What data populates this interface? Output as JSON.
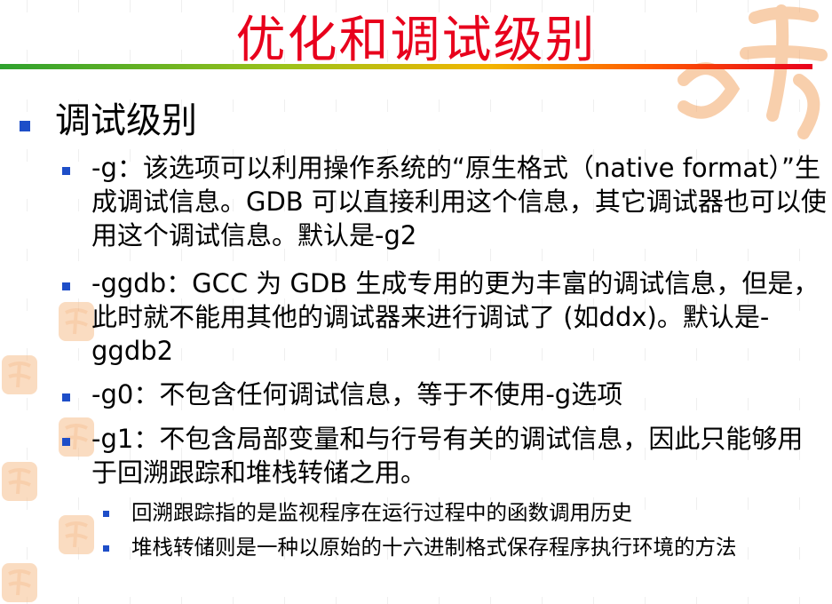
{
  "slide": {
    "title": "优化和调试级别",
    "heading": "调试级别",
    "items": [
      "-g：该选项可以利用操作系统的“原生格式（native format）”生成调试信息。GDB 可以直接利用这个信息，其它调试器也可以使用这个调试信息。默认是-g2",
      "-ggdb：GCC 为 GDB 生成专用的更为丰富的调试信息，但是，此时就不能用其他的调试器来进行调试了 (如ddx)。默认是-ggdb2",
      "-g0：不包含任何调试信息，等于不使用-g选项",
      "-g1：不包含局部变量和与行号有关的调试信息，因此只能够用于回溯跟踪和堆栈转储之用。"
    ],
    "subitems": [
      "回溯跟踪指的是监视程序在运行过程中的函数调用历史",
      "堆栈转储则是一种以原始的十六进制格式保存程序执行环境的方法"
    ]
  },
  "colors": {
    "title": "#e8001c",
    "bullet": "#1e4ec8",
    "text": "#000000",
    "decoration": "#f4a86a"
  }
}
